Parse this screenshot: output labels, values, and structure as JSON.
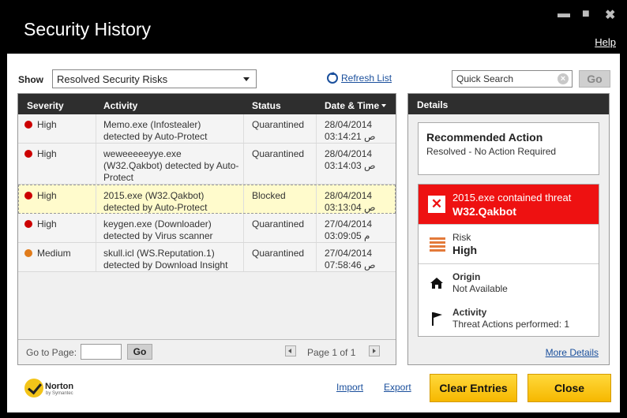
{
  "window": {
    "title": "Security History",
    "help": "Help",
    "min": "▬",
    "max": "■",
    "close": "✖"
  },
  "toolbar": {
    "show_label": "Show",
    "show_value": "Resolved Security Risks",
    "refresh_label": "Refresh List",
    "search_placeholder": "Quick Search",
    "search_go": "Go"
  },
  "table": {
    "columns": [
      "Severity",
      "Activity",
      "Status",
      "Date & Time"
    ],
    "rows": [
      {
        "severity": "High",
        "severity_color": "#cc0000",
        "activity1": "Memo.exe (Infostealer)",
        "activity2": "detected by Auto-Protect",
        "activity3": "",
        "status": "Quarantined",
        "date": "28/04/2014",
        "time": "03:14:21 ص"
      },
      {
        "severity": "High",
        "severity_color": "#cc0000",
        "activity1": "weweeeeeyye.exe",
        "activity2": "(W32.Qakbot) detected by Auto-",
        "activity3": "Protect",
        "status": "Quarantined",
        "date": "28/04/2014",
        "time": "03:14:03 ص"
      },
      {
        "severity": "High",
        "severity_color": "#cc0000",
        "activity1": "2015.exe (W32.Qakbot)",
        "activity2": "detected by Auto-Protect",
        "activity3": "",
        "status": "Blocked",
        "date": "28/04/2014",
        "time": "03:13:04 ص"
      },
      {
        "severity": "High",
        "severity_color": "#cc0000",
        "activity1": "keygen.exe (Downloader)",
        "activity2": "detected by Virus scanner",
        "activity3": "",
        "status": "Quarantined",
        "date": "27/04/2014",
        "time": "03:09:05 م"
      },
      {
        "severity": "Medium",
        "severity_color": "#e07b1a",
        "activity1": "skull.icl (WS.Reputation.1)",
        "activity2": "detected by Download Insight",
        "activity3": "",
        "status": "Quarantined",
        "date": "27/04/2014",
        "time": "07:58:46 ص"
      }
    ],
    "goto_label": "Go to Page:",
    "goto_button": "Go",
    "page_label": "Page 1 of 1"
  },
  "details": {
    "header": "Details",
    "recommended_title": "Recommended Action",
    "recommended_value": "Resolved - No Action Required",
    "threat_line1": "2015.exe contained threat",
    "threat_line2": "W32.Qakbot",
    "risk_label": "Risk",
    "risk_value": "High",
    "origin_label": "Origin",
    "origin_value": "Not Available",
    "activity_label": "Activity",
    "activity_value": "Threat Actions performed: 1",
    "more_details": "More Details"
  },
  "footer": {
    "brand_name": "Norton",
    "brand_sub": "by Symantec",
    "import": "Import",
    "export": "Export",
    "clear_entries": "Clear Entries",
    "close": "Close"
  }
}
